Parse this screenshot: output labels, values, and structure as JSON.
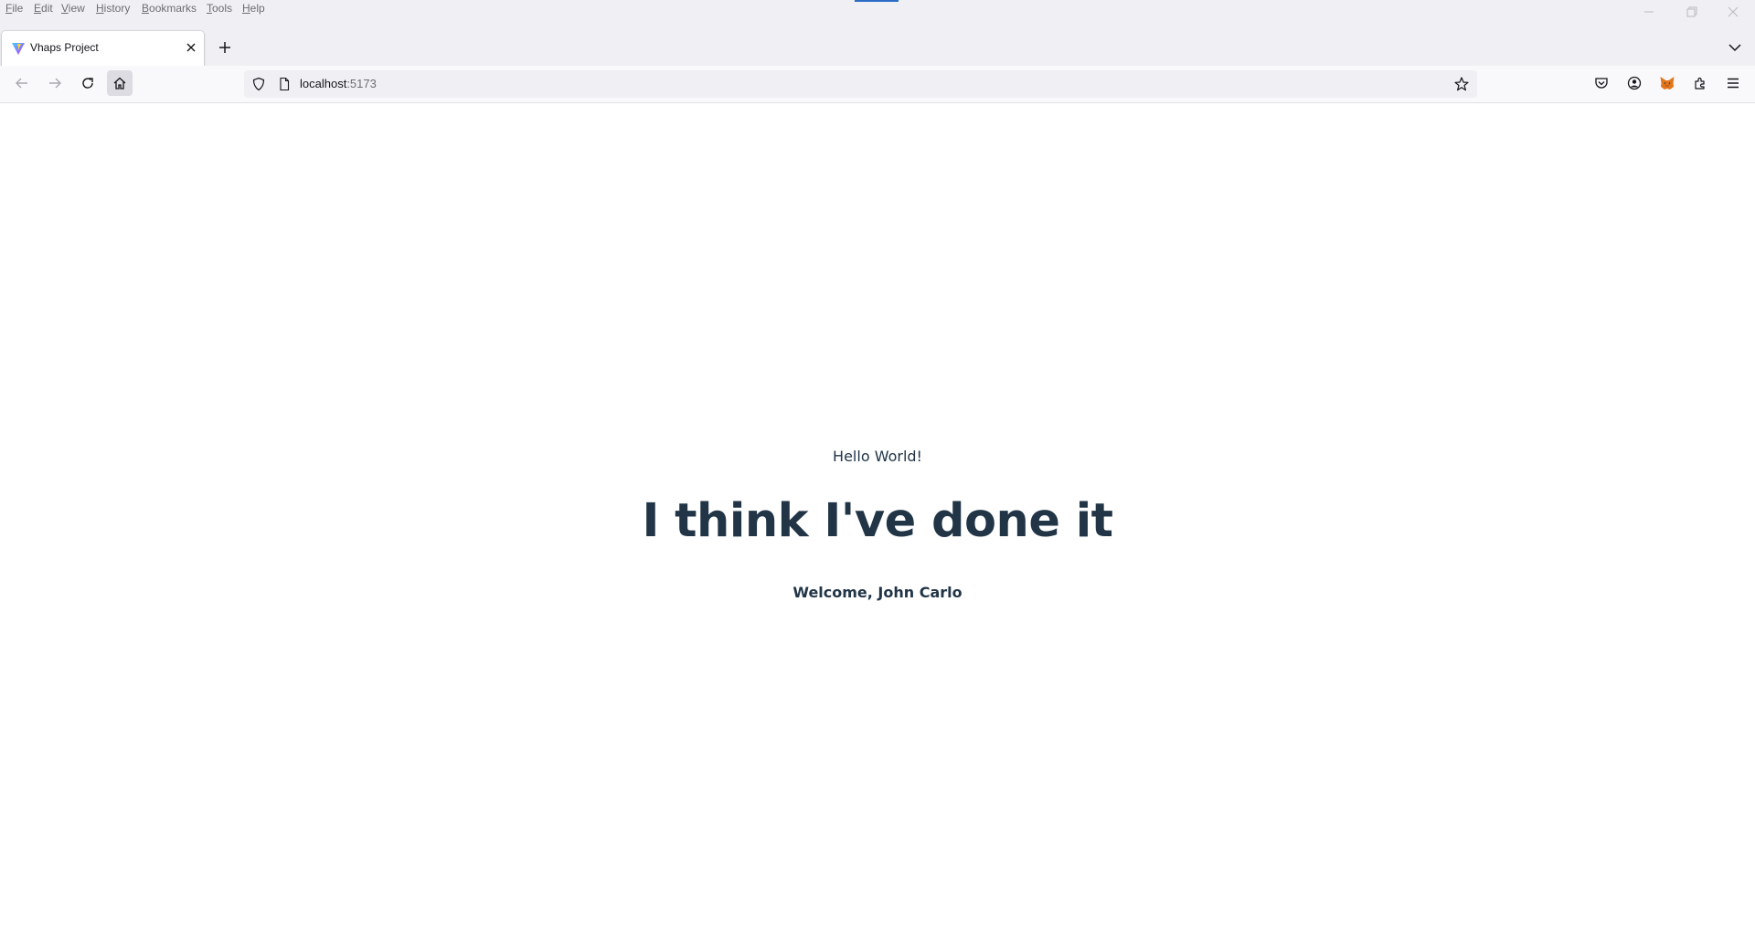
{
  "menubar": {
    "items": [
      {
        "label": "File",
        "mnemonic": "F",
        "rest": "ile"
      },
      {
        "label": "Edit",
        "mnemonic": "E",
        "rest": "dit"
      },
      {
        "label": "View",
        "mnemonic": "V",
        "rest": "iew"
      },
      {
        "label": "History",
        "mnemonic": "H",
        "rest": "istory"
      },
      {
        "label": "Bookmarks",
        "mnemonic": "B",
        "rest": "ookmarks"
      },
      {
        "label": "Tools",
        "mnemonic": "T",
        "rest": "ools"
      },
      {
        "label": "Help",
        "mnemonic": "H",
        "rest": "elp"
      }
    ]
  },
  "tabs": [
    {
      "title": "Vhaps Project",
      "favicon": "vite-logo-icon",
      "active": true
    }
  ],
  "navbar": {
    "url_host": "localhost",
    "url_port": ":5173",
    "buttons": [
      "back-icon",
      "forward-icon",
      "reload-icon",
      "home-icon"
    ],
    "toolbar_icons": [
      "pocket-icon",
      "account-icon",
      "metamask-fox-icon",
      "extensions-icon",
      "menu-icon"
    ]
  },
  "page": {
    "greeting": "Hello World!",
    "headline": "I think I've done it",
    "welcome": "Welcome, John Carlo"
  },
  "colors": {
    "chrome_bg": "#f0f0f4",
    "text_primary": "#213547",
    "url_port": "#6e6e72"
  }
}
